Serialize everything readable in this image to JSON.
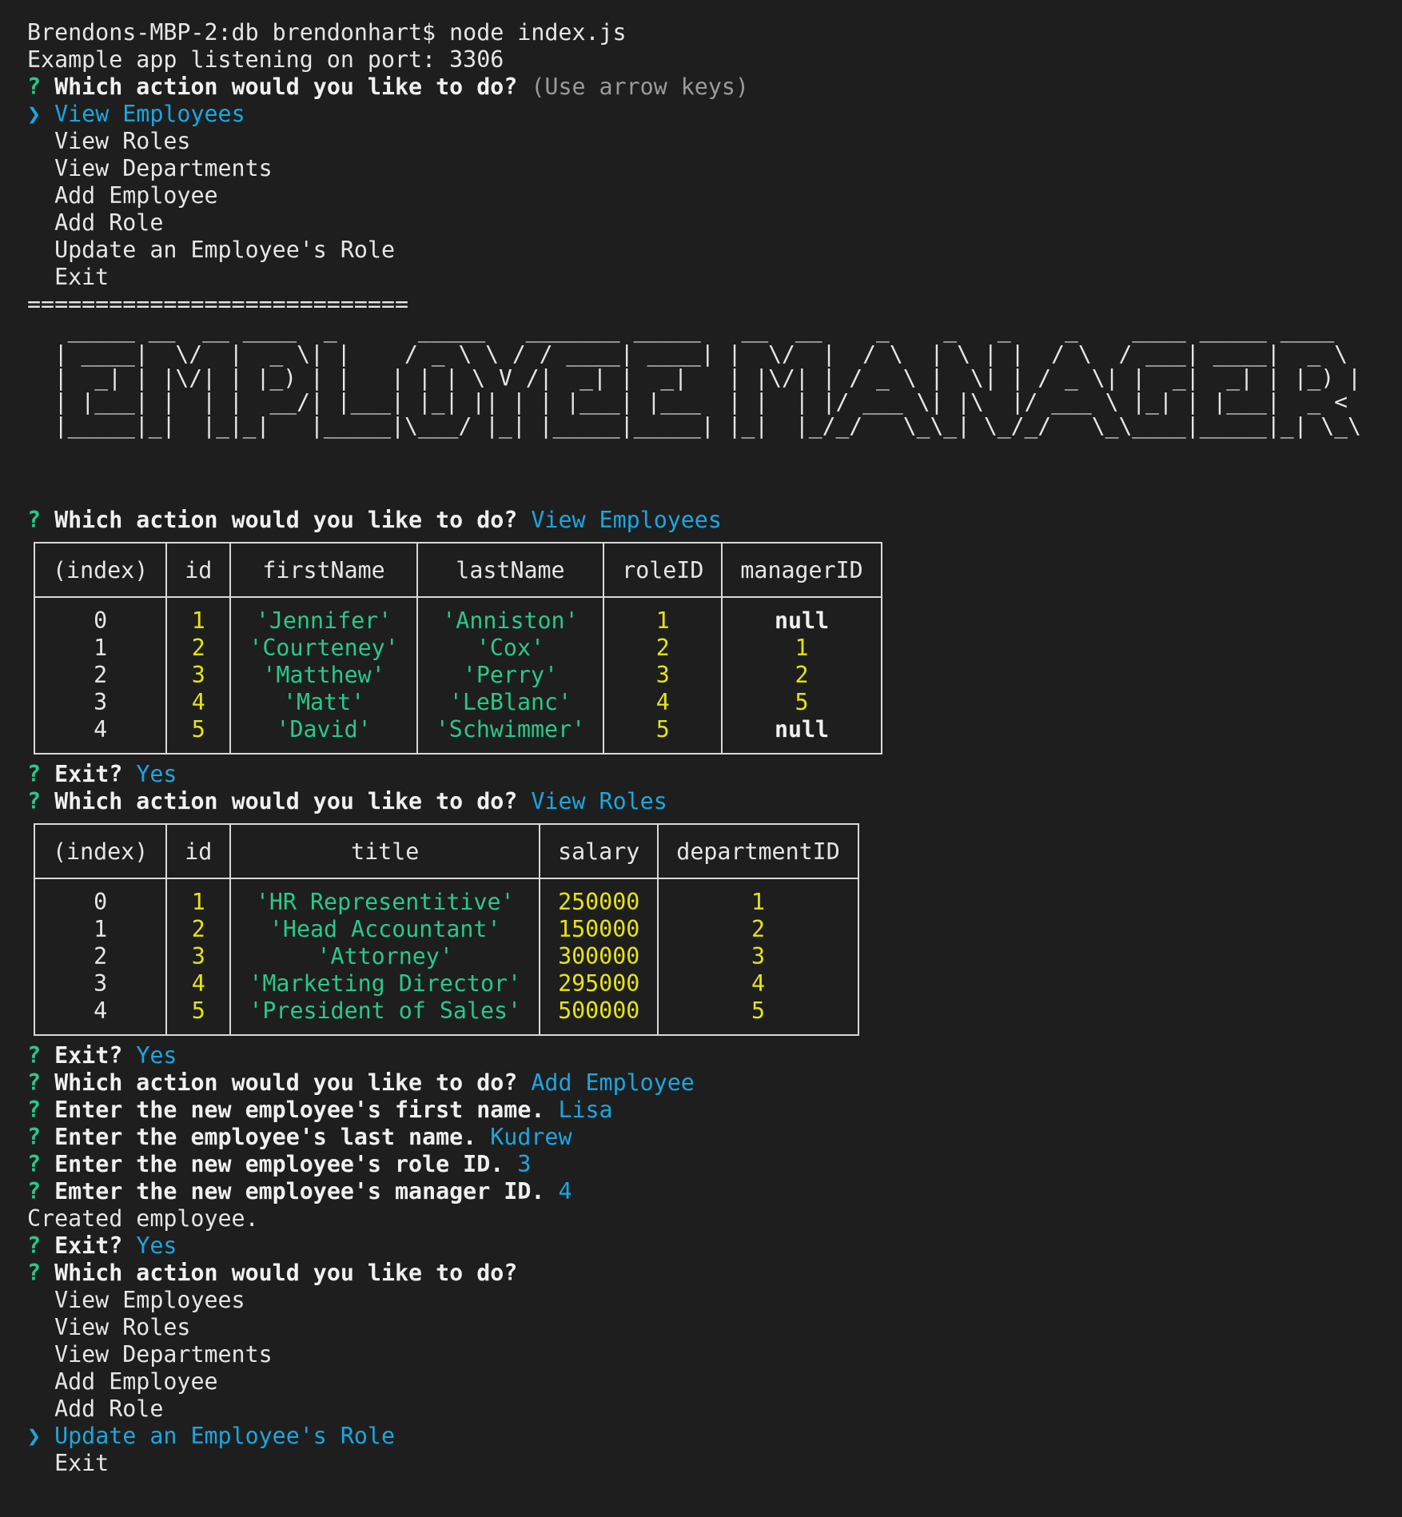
{
  "session": {
    "prompt_line": "Brendons-MBP-2:db brendonhart$ node index.js",
    "listening": "Example app listening on port: 3306",
    "q_mark": "?",
    "pointer": "❯",
    "action_question": "Which action would you like to do?",
    "hint": "(Use arrow keys)",
    "menu1": [
      "View Employees",
      "View Roles",
      "View Departments",
      "Add Employee",
      "Add Role",
      "Update an Employee's Role",
      "Exit"
    ],
    "divider": "============================"
  },
  "banner": {
    "art": "   _____ __  __ ____  _      _____   _______ _____   __  __    _    _   _    _    ____ _____ ____  \n  | ____|  \\/  |  _ \\| |    / _ \\ \\ / / ____| ____| |  \\/  |  / \\  | \\ | |  / \\  / ___| ____|  _ \\ \n  |  _| | |\\/| | |_) | |   | | | \\ V /|  _| |  _|   | |\\/| | / _ \\ |  \\| | / _ \\| |  _|  _| | |_) |\n  | |___| |  | |  __/| |___| |_| || | | |___| |___  | |  | |/ ___ \\| |\\  |/ ___ \\ |_| | |___|  _ < \n  |_____|_|  |_|_|   |_____|\\___/ |_| |_____|_____| |_|  |_/_/   \\_\\_| \\_/_/   \\_\\____|_____|_| \\_\\"
  },
  "step1": {
    "question": "Which action would you like to do?",
    "answer": "View Employees"
  },
  "employees_table": {
    "headers": [
      "(index)",
      "id",
      "firstName",
      "lastName",
      "roleID",
      "managerID"
    ],
    "rows": [
      [
        "0",
        "1",
        "'Jennifer'",
        "'Anniston'",
        "1",
        "null"
      ],
      [
        "1",
        "2",
        "'Courteney'",
        "'Cox'",
        "2",
        "1"
      ],
      [
        "2",
        "3",
        "'Matthew'",
        "'Perry'",
        "3",
        "2"
      ],
      [
        "3",
        "4",
        "'Matt'",
        "'LeBlanc'",
        "4",
        "5"
      ],
      [
        "4",
        "5",
        "'David'",
        "'Schwimmer'",
        "5",
        "null"
      ]
    ]
  },
  "step2": {
    "exit_q": "Exit?",
    "exit_a": "Yes",
    "question": "Which action would you like to do?",
    "answer": "View Roles"
  },
  "roles_table": {
    "headers": [
      "(index)",
      "id",
      "title",
      "salary",
      "departmentID"
    ],
    "rows": [
      [
        "0",
        "1",
        "'HR Representitive'",
        "250000",
        "1"
      ],
      [
        "1",
        "2",
        "'Head Accountant'",
        "150000",
        "2"
      ],
      [
        "2",
        "3",
        "'Attorney'",
        "300000",
        "3"
      ],
      [
        "3",
        "4",
        "'Marketing Director'",
        "295000",
        "4"
      ],
      [
        "4",
        "5",
        "'President of Sales'",
        "500000",
        "5"
      ]
    ]
  },
  "step3": {
    "exit_q": "Exit?",
    "exit_a": "Yes",
    "question": "Which action would you like to do?",
    "answer": "Add Employee",
    "first_q": "Enter the new employee's first name.",
    "first_a": "Lisa",
    "last_q": "Enter the employee's last name.",
    "last_a": "Kudrew",
    "role_q": "Enter the new employee's role ID.",
    "role_a": "3",
    "mgr_q": "Emter the new employee's manager ID.",
    "mgr_a": "4",
    "created": "Created employee.",
    "exit_q2": "Exit?",
    "exit_a2": "Yes",
    "question2": "Which action would you like to do?"
  },
  "menu2": [
    "View Employees",
    "View Roles",
    "View Departments",
    "Add Employee",
    "Add Role",
    "Update an Employee's Role",
    "Exit"
  ],
  "colors": {
    "background": "#1e1e1e",
    "text": "#e6e6e6",
    "question_mark": "#28c98a",
    "answer_cyan": "#1aa7e0",
    "string_green": "#28c98a",
    "number_yellow": "#e5e510"
  }
}
